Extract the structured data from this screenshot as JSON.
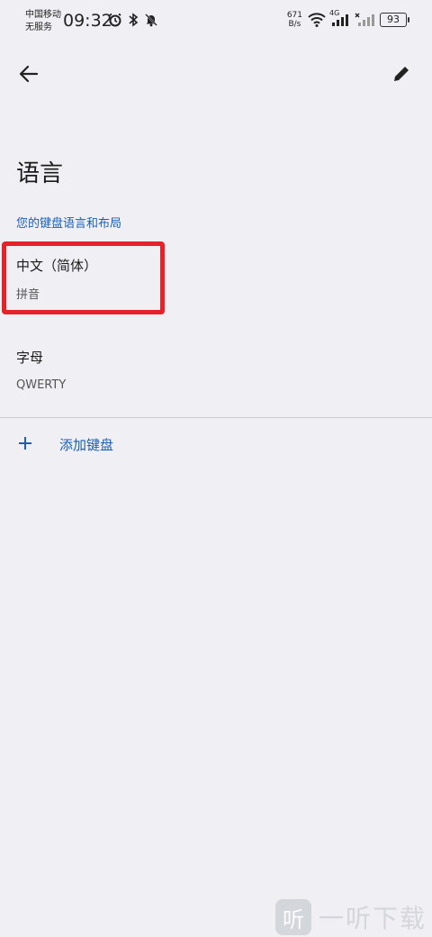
{
  "status_bar": {
    "carrier_line1": "中国移动",
    "carrier_line2": "无服务",
    "time": "09:32",
    "net_speed_value": "671",
    "net_speed_unit": "B/s",
    "network_type": "4G",
    "battery": "93"
  },
  "header": {
    "title": "语言"
  },
  "section": {
    "header": "您的键盘语言和布局"
  },
  "keyboards": [
    {
      "title": "中文（简体）",
      "subtitle": "拼音"
    },
    {
      "title": "字母",
      "subtitle": "QWERTY"
    }
  ],
  "add_keyboard": {
    "label": "添加键盘"
  },
  "watermark": {
    "logo": "听",
    "text": "一听下载"
  },
  "colors": {
    "accent": "#1a5fb4",
    "highlight": "#e5212a",
    "background": "#f0eff4"
  },
  "icons": [
    "back-arrow-icon",
    "pencil-icon",
    "plus-icon",
    "alarm-icon",
    "bluetooth-icon",
    "mute-bell-icon",
    "wifi-icon",
    "signal-icon",
    "battery-icon"
  ]
}
